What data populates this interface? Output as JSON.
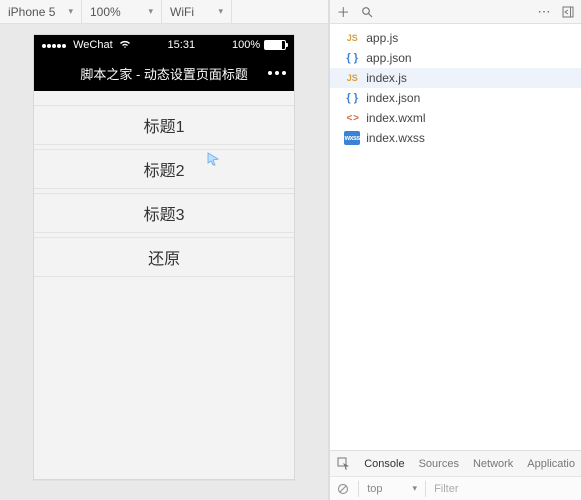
{
  "left_toolbar": {
    "device": "iPhone 5",
    "zoom": "100%",
    "network": "WiFi"
  },
  "simulator": {
    "status_bar": {
      "carrier": "WeChat",
      "time": "15:31",
      "battery_pct": "100%"
    },
    "nav_title": "脚本之家 - 动态设置页面标题",
    "rows": [
      "标题1",
      "标题2",
      "标题3",
      "还原"
    ]
  },
  "file_tree": {
    "files": [
      {
        "name": "app.js",
        "icon": "js",
        "selected": false
      },
      {
        "name": "app.json",
        "icon": "json",
        "selected": false
      },
      {
        "name": "index.js",
        "icon": "js",
        "selected": true
      },
      {
        "name": "index.json",
        "icon": "json",
        "selected": false
      },
      {
        "name": "index.wxml",
        "icon": "wxml",
        "selected": false
      },
      {
        "name": "index.wxss",
        "icon": "wxss",
        "selected": false
      }
    ]
  },
  "devtools": {
    "tabs": [
      "Console",
      "Sources",
      "Network",
      "Applicatio"
    ],
    "active_tab": "Console",
    "console": {
      "context": "top",
      "filter_placeholder": "Filter"
    }
  },
  "icons": {
    "js": "JS",
    "json": "{ }",
    "wxml": "< >",
    "wxss": "wxss"
  }
}
